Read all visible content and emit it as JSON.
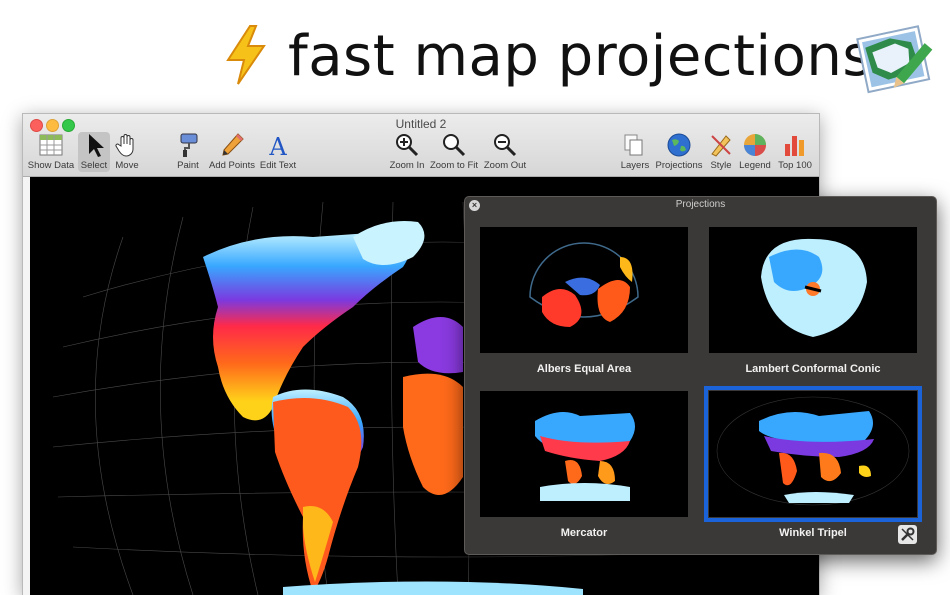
{
  "headline": {
    "text": "fast map projections"
  },
  "window": {
    "title": "Untitled 2",
    "toolbar": {
      "show_data": "Show Data",
      "select": "Select",
      "move": "Move",
      "paint": "Paint",
      "add_points": "Add Points",
      "edit_text": "Edit Text",
      "zoom_in": "Zoom In",
      "zoom_to_fit": "Zoom to Fit",
      "zoom_out": "Zoom Out",
      "layers": "Layers",
      "projections": "Projections",
      "style": "Style",
      "legend": "Legend",
      "top100": "Top 100"
    },
    "active_tool": "Select"
  },
  "projections_panel": {
    "title": "Projections",
    "items": [
      {
        "label": "Albers Equal Area"
      },
      {
        "label": "Lambert Conformal Conic"
      },
      {
        "label": "Mercator"
      },
      {
        "label": "Winkel Tripel",
        "selected": true
      }
    ]
  },
  "colors": {
    "accent_selection": "#1a63d8",
    "panel_bg": "#3b3937",
    "map_bg": "#000000"
  },
  "icons": [
    "lightning-icon",
    "app-icon",
    "table-icon",
    "arrow-cursor-icon",
    "hand-icon",
    "paint-roller-icon",
    "pencil-icon",
    "text-a-icon",
    "zoom-in-icon",
    "zoom-fit-icon",
    "zoom-out-icon",
    "layers-icon",
    "globe-icon",
    "style-icon",
    "legend-icon",
    "bar-chart-icon",
    "wrench-icon"
  ]
}
